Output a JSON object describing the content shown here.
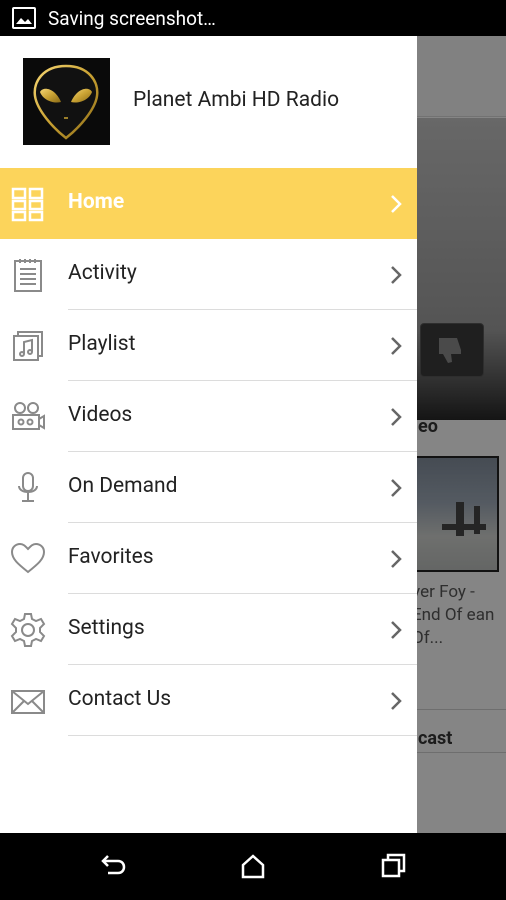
{
  "status_bar": {
    "text": "Saving screenshot…",
    "icon": "image-icon"
  },
  "drawer": {
    "app_title": "Planet Ambi HD Radio",
    "menu": [
      {
        "label": "Home",
        "icon": "grid-icon",
        "active": true
      },
      {
        "label": "Activity",
        "icon": "notepad-icon"
      },
      {
        "label": "Playlist",
        "icon": "music-note-icon"
      },
      {
        "label": "Videos",
        "icon": "video-camera-icon"
      },
      {
        "label": "On Demand",
        "icon": "microphone-icon"
      },
      {
        "label": "Favorites",
        "icon": "heart-icon"
      },
      {
        "label": "Settings",
        "icon": "gear-icon"
      },
      {
        "label": "Contact Us",
        "icon": "envelope-icon"
      }
    ],
    "accent_color": "#fcd45b"
  },
  "background": {
    "section_heading": "eo",
    "video_title": "ver Foy - End Of ean Of...",
    "section_heading_2": "cast"
  },
  "nav_bar": {
    "back": "back-icon",
    "home": "home-icon",
    "recents": "recents-icon"
  }
}
